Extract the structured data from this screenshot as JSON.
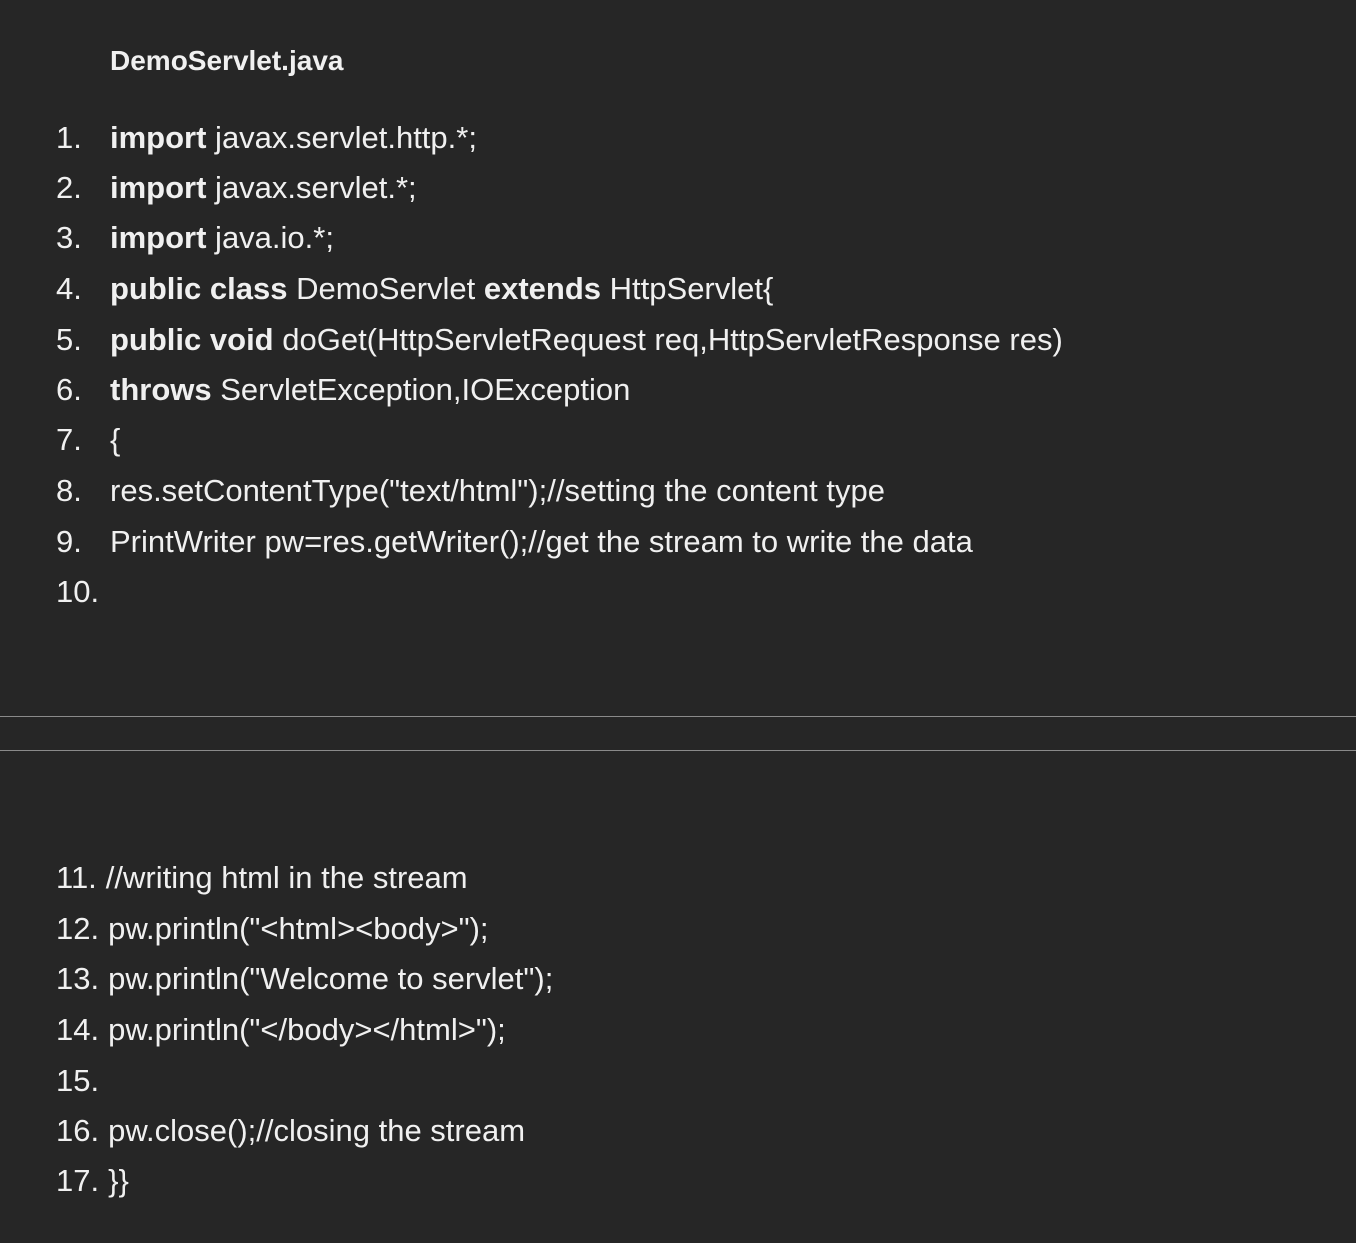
{
  "title": "DemoServlet.java",
  "page1": [
    {
      "num": "1.",
      "kw1": "import",
      "t1": " javax.servlet.http.*;",
      "kw2": "",
      "t2": ""
    },
    {
      "num": "2.",
      "kw1": "import",
      "t1": " javax.servlet.*;",
      "kw2": "",
      "t2": ""
    },
    {
      "num": "3.",
      "kw1": "import",
      "t1": " java.io.*;",
      "kw2": "",
      "t2": ""
    },
    {
      "num": "4.",
      "kw1": "public class",
      "t1": " DemoServlet ",
      "kw2": "extends",
      "t2": " HttpServlet{"
    },
    {
      "num": "5.",
      "kw1": "public void",
      "t1": " doGet(HttpServletRequest req,HttpServletResponse res)",
      "kw2": "",
      "t2": ""
    },
    {
      "num": "6.",
      "kw1": "throws",
      "t1": " ServletException,IOException",
      "kw2": "",
      "t2": ""
    },
    {
      "num": "7.",
      "kw1": "",
      "t1": "{",
      "kw2": "",
      "t2": ""
    },
    {
      "num": "8.",
      "kw1": "",
      "t1": "res.setContentType(\"text/html\");//setting the content type",
      "kw2": "",
      "t2": ""
    },
    {
      "num": "9.",
      "kw1": "",
      "t1": "PrintWriter pw=res.getWriter();//get the stream to write the data",
      "kw2": "",
      "t2": ""
    },
    {
      "num": "10.",
      "kw1": "",
      "t1": "",
      "kw2": "",
      "t2": ""
    }
  ],
  "page2": [
    {
      "num": "11.",
      "text": "//writing html in the stream"
    },
    {
      "num": "12.",
      "text": "pw.println(\"<html><body>\");"
    },
    {
      "num": "13.",
      "text": "pw.println(\"Welcome to servlet\");"
    },
    {
      "num": "14.",
      "text": "pw.println(\"</body></html>\");"
    },
    {
      "num": "15.",
      "text": ""
    },
    {
      "num": "16.",
      "text": "pw.close();//closing the stream"
    },
    {
      "num": "17.",
      "text": "}}"
    }
  ]
}
